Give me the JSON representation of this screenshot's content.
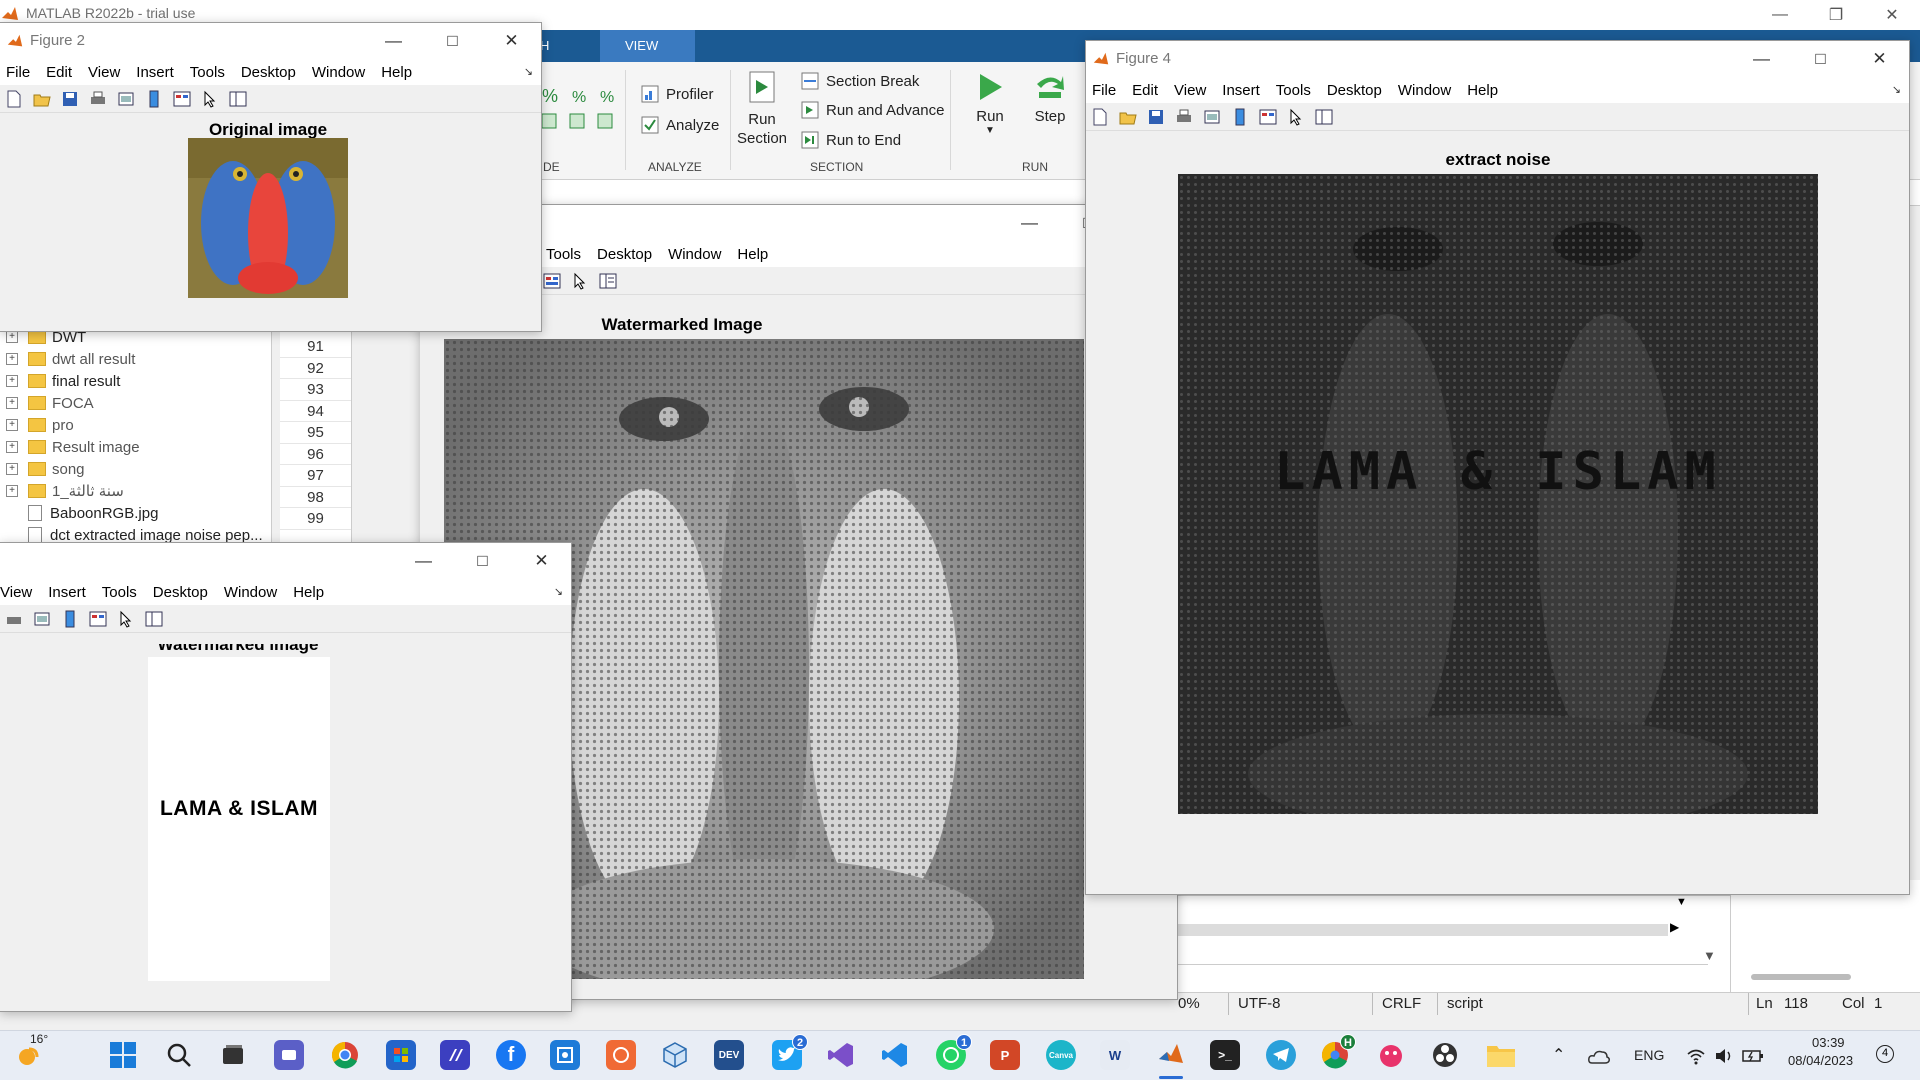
{
  "main_window": {
    "title": "MATLAB R2022b - trial use",
    "tabs": [
      {
        "label": "H"
      },
      {
        "label": "VIEW"
      }
    ]
  },
  "ribbon": {
    "profiler": "Profiler",
    "analyze": "Analyze",
    "analyze_group": "ANALYZE",
    "code_group_suffix": "DE",
    "run_section": "Run\nSection",
    "section_break": "Section Break",
    "run_and_advance": "Run and Advance",
    "run_to_end": "Run to End",
    "section_group": "SECTION",
    "run": "Run",
    "step": "Step",
    "run_group": "RUN"
  },
  "folder_panel": {
    "items": [
      {
        "label": "DWT",
        "type": "folder"
      },
      {
        "label": "dwt all result",
        "type": "folder"
      },
      {
        "label": "final result",
        "type": "folder"
      },
      {
        "label": "FOCA",
        "type": "folder"
      },
      {
        "label": "pro",
        "type": "folder"
      },
      {
        "label": "Result image",
        "type": "folder"
      },
      {
        "label": "song",
        "type": "folder"
      },
      {
        "label": "سنة ثالثة_1",
        "type": "folder"
      },
      {
        "label": "BaboonRGB.jpg",
        "type": "file"
      },
      {
        "label": "dct extracted image noise pep...",
        "type": "file"
      }
    ]
  },
  "editor": {
    "line_numbers": [
      "91",
      "92",
      "93",
      "94",
      "95",
      "96",
      "97",
      "98",
      "99"
    ]
  },
  "status_bar": {
    "zoom": "0%",
    "encoding": "UTF-8",
    "line_ending": "CRLF",
    "file_type": "script",
    "ln_label": "Ln",
    "ln_value": "118",
    "col_label": "Col",
    "col_value": "1"
  },
  "figures": {
    "figure2": {
      "title": "Figure 2",
      "menu": [
        "File",
        "Edit",
        "View",
        "Insert",
        "Tools",
        "Desktop",
        "Window",
        "Help"
      ],
      "axes_title": "Original image"
    },
    "watermarked_large": {
      "menu": [
        "Tools",
        "Desktop",
        "Window",
        "Help"
      ],
      "axes_title": "Watermarked Image"
    },
    "watermark_small": {
      "menu": [
        "View",
        "Insert",
        "Tools",
        "Desktop",
        "Window",
        "Help"
      ],
      "axes_title": "Watermarked image",
      "image_text": "LAMA & ISLAM"
    },
    "figure4": {
      "title": "Figure 4",
      "menu": [
        "File",
        "Edit",
        "View",
        "Insert",
        "Tools",
        "Desktop",
        "Window",
        "Help"
      ],
      "axes_title": "extract noise",
      "image_text": "LAMA & ISLAM"
    }
  },
  "taskbar": {
    "weather_temp": "16°",
    "language": "ENG",
    "time": "03:39",
    "date": "08/04/2023",
    "notification_count": "4",
    "twitter_badge": "2",
    "whatsapp_badge": "1",
    "chrome_badge": "H"
  }
}
